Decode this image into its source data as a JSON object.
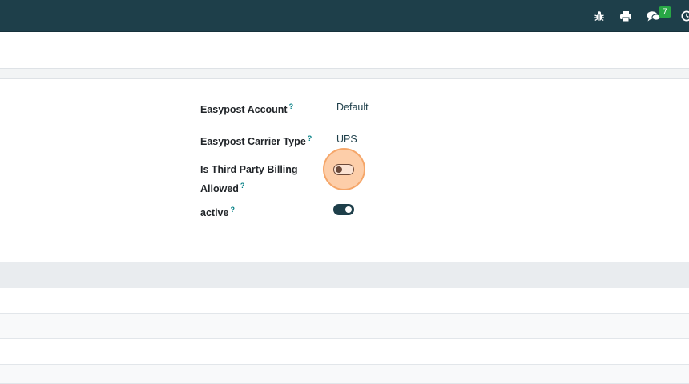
{
  "topbar": {
    "icons": [
      "bug-icon",
      "print-icon",
      "chat-icon",
      "clock-icon"
    ],
    "messages_count": "7",
    "colors": {
      "bar": "#1e3f4a",
      "badge": "#28a745"
    }
  },
  "form": {
    "fields": [
      {
        "label": "Easypost Account",
        "help": "?",
        "value": "Default"
      },
      {
        "label": "Easypost Carrier Type",
        "help": "?",
        "value": "UPS"
      },
      {
        "label_line1": "Is Third Party Billing",
        "label_line2": "Allowed",
        "help": "?",
        "checked": false
      },
      {
        "label": "active",
        "help": "?",
        "checked": true
      }
    ]
  }
}
